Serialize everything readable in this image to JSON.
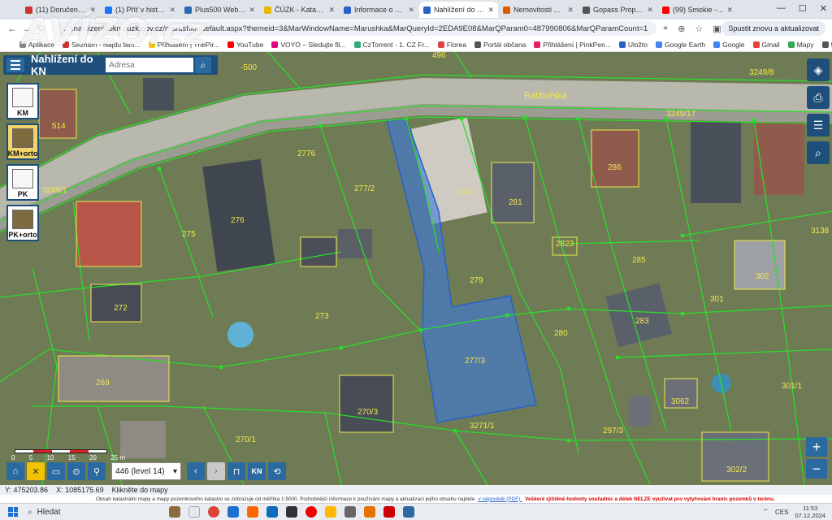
{
  "browser": {
    "tabs": [
      {
        "label": "(11) Doručené – Sezn",
        "color": "#c33"
      },
      {
        "label": "(1) Příť v historickýc",
        "color": "#1877f2"
      },
      {
        "label": "Plus500 Webová plat",
        "color": "#2d6bb5"
      },
      {
        "label": "ČÚZK - Katastrální m",
        "color": "#e6b800"
      },
      {
        "label": "Informace o pozemk",
        "color": "#2a62c9"
      },
      {
        "label": "Nahlížení do katastr",
        "color": "#2a62c9",
        "active": true
      },
      {
        "label": "Nemovitosti na prod",
        "color": "#e05a00"
      },
      {
        "label": "Gopass Property – Irr",
        "color": "#555"
      },
      {
        "label": "(99) Smokie - Lay",
        "color": "#f00"
      }
    ],
    "url": "...l.nahlizenidokn.cuzk.gov.cz/marushka/default.aspx?themeid=3&MarWindowName=Marushka&MarQueryId=2EDA9E08&MarQParam0=487990806&MarQParamCount=1",
    "update_button": "Spustit znovu a aktualizovat",
    "bookmarks": [
      {
        "label": "Aplikace",
        "color": "#888"
      },
      {
        "label": "Seznam - Najdu tam...",
        "color": "#c33"
      },
      {
        "label": "Přihlášení | ThePir...",
        "color": "#f5c518"
      },
      {
        "label": "YouTube",
        "color": "#f00"
      },
      {
        "label": "VOYO – Sledujte fil...",
        "color": "#e6007e"
      },
      {
        "label": "CzTorrent - 1. CZ Fr...",
        "color": "#3a7"
      },
      {
        "label": "Florea",
        "color": "#d44"
      },
      {
        "label": "Portál občana",
        "color": "#555"
      },
      {
        "label": "Přihlášení | PinkPen...",
        "color": "#e91e63"
      },
      {
        "label": "Uložto",
        "color": "#2a62c9"
      },
      {
        "label": "Google Earth",
        "color": "#4285f4"
      },
      {
        "label": "Google",
        "color": "#4285f4"
      },
      {
        "label": "Gmail",
        "color": "#ea4335"
      },
      {
        "label": "Mapy",
        "color": "#34a853"
      },
      {
        "label": "9",
        "color": "#555"
      },
      {
        "label": "https://radia.cz/radi...",
        "color": "#888"
      }
    ],
    "watermark": "AVÍZO.cz"
  },
  "app": {
    "title": "Nahlížení do KN",
    "search_placeholder": "Adresa",
    "layers": [
      {
        "label": "KM",
        "active": false
      },
      {
        "label": "KM+orto",
        "active": true
      },
      {
        "label": "PK",
        "active": false
      },
      {
        "label": "PK+orto",
        "active": false
      }
    ],
    "level_select": "446 (level 14)",
    "scale_labels": [
      "0",
      "5",
      "10",
      "15",
      "20",
      "25 m"
    ],
    "bottom_text_buttons": [
      "KN"
    ],
    "status": {
      "y": "Y: 475203.86",
      "x": "X: 1085175.69",
      "hint": "Klikněte do mapy"
    },
    "info_text": "Obsah katastrální mapy a mapy pozemkového katastru se zobrazuje od měřítka 1:5000. Podrobnější informace k používání mapy a aktualizaci jejího obsahu najdete",
    "info_link": "v nápovědě (PDF).",
    "info_warning": "Veškeré zjištěné hodnoty souřadnic a délek NELZE využívat pro vytyčování hranic pozemků v terénu."
  },
  "map": {
    "street_label": "Ratibořská",
    "parcel_labels": [
      "496",
      "3249/8",
      "514",
      "-500",
      "3249/17",
      "2776",
      "277/2",
      "278",
      "281",
      "286",
      "3249/1",
      "276",
      "275",
      "2823",
      "3138",
      "285",
      "302",
      "279",
      "273",
      "301",
      "272",
      "280",
      "283",
      "277/3",
      "269",
      "301/1",
      "270/3",
      "3271/1",
      "3062",
      "270/1",
      "297/3",
      "302/2"
    ]
  },
  "taskbar": {
    "search": "Hledat",
    "tray_lang": "CES",
    "time": "11:53",
    "date": "07.12.2024"
  }
}
